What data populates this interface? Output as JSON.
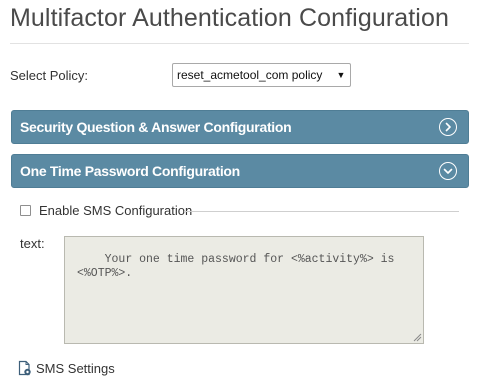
{
  "page": {
    "title": "Multifactor Authentication Configuration"
  },
  "policy": {
    "label": "Select Policy:",
    "selected": "reset_acmetool_com policy"
  },
  "sections": {
    "security_qa": {
      "label": "Security Question & Answer Configuration",
      "state": "collapsed",
      "icon": "chevron-right-circle-icon"
    },
    "otp": {
      "label": "One Time Password Configuration",
      "state": "expanded",
      "icon": "chevron-down-circle-icon"
    }
  },
  "sms": {
    "enable_label": "Enable SMS Configuration",
    "enabled": false,
    "text_label": "text:",
    "message": "Your one time password for <%activity%> is <%OTP%>.",
    "settings_label": "SMS Settings",
    "settings_icon": "document-gear-icon"
  },
  "colors": {
    "section_header_bg": "#5b8aa3",
    "disabled_textarea_bg": "#ebebe4"
  }
}
